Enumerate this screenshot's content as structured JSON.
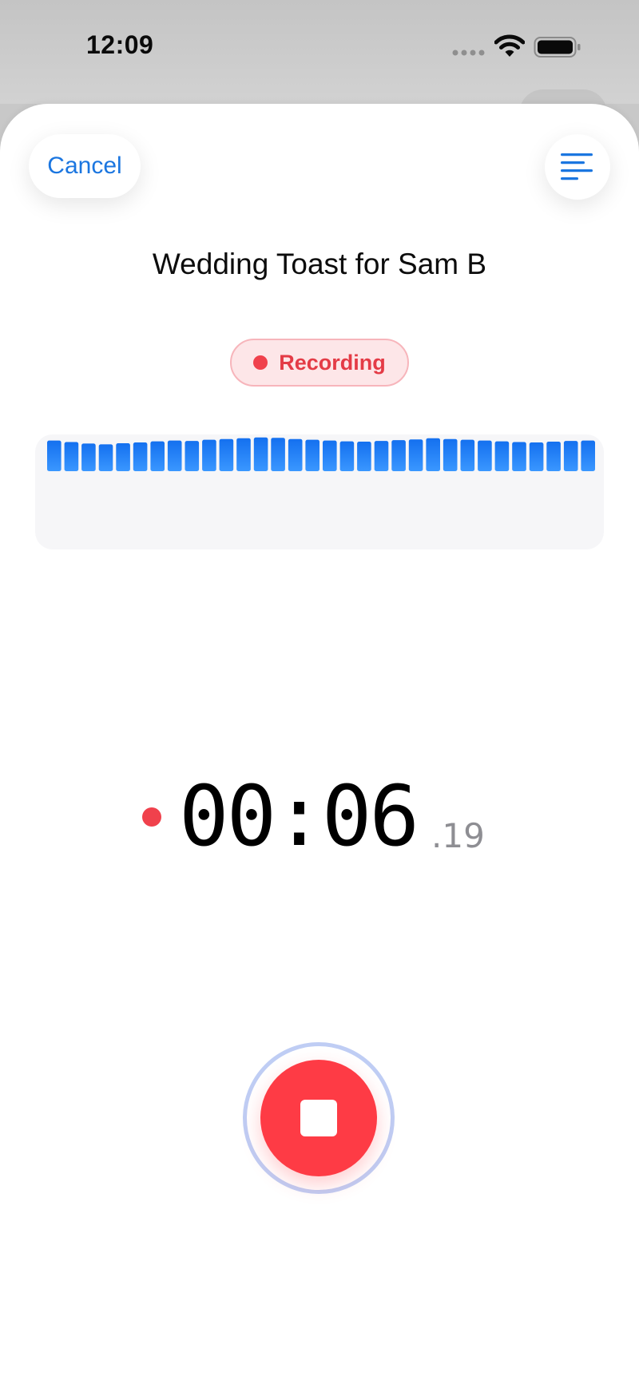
{
  "status_bar": {
    "time": "12:09"
  },
  "header": {
    "cancel_label": "Cancel",
    "menu_icon": "text-align-left-icon"
  },
  "recording": {
    "title": "Wedding Toast for Sam B",
    "status_label": "Recording",
    "timer_main": "00:06",
    "timer_fraction": ".19"
  },
  "waveform": {
    "bar_levels": [
      0.8,
      0.76,
      0.72,
      0.7,
      0.73,
      0.75,
      0.78,
      0.8,
      0.79,
      0.82,
      0.84,
      0.86,
      0.88,
      0.87,
      0.84,
      0.82,
      0.8,
      0.78,
      0.77,
      0.79,
      0.81,
      0.83,
      0.86,
      0.84,
      0.82,
      0.8,
      0.78,
      0.76,
      0.75,
      0.77,
      0.79,
      0.8
    ]
  },
  "controls": {
    "stop_icon": "stop-icon"
  },
  "colors": {
    "accent_blue": "#1b76e0",
    "waveform_blue": "#1a7ff7",
    "recording_red": "#fe3b45",
    "badge_background": "#fde6e8",
    "timer_fraction_gray": "#8e8e93"
  }
}
